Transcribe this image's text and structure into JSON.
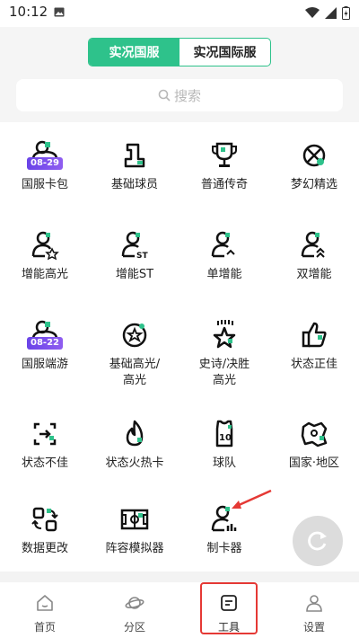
{
  "status": {
    "time": "10:12"
  },
  "server_tabs": [
    {
      "label": "实况国服",
      "active": true
    },
    {
      "label": "实况国际服",
      "active": false
    }
  ],
  "search": {
    "placeholder": "搜索"
  },
  "tools": [
    {
      "label": "国服卡包",
      "icon": "card-pack-icon",
      "badge": "08-29"
    },
    {
      "label": "基础球员",
      "icon": "base-player-icon"
    },
    {
      "label": "普通传奇",
      "icon": "trophy-icon"
    },
    {
      "label": "梦幻精选",
      "icon": "dream-select-icon"
    },
    {
      "label": "增能高光",
      "icon": "highlight-player-icon"
    },
    {
      "label": "增能ST",
      "icon": "st-player-icon"
    },
    {
      "label": "单增能",
      "icon": "single-boost-icon"
    },
    {
      "label": "双增能",
      "icon": "double-boost-icon"
    },
    {
      "label": "国服端游",
      "icon": "pc-pack-icon",
      "badge": "08-22"
    },
    {
      "label": "基础高光/\n高光",
      "icon": "star-circle-icon"
    },
    {
      "label": "史诗/决胜\n高光",
      "icon": "epic-star-icon"
    },
    {
      "label": "状态正佳",
      "icon": "thumbs-up-icon"
    },
    {
      "label": "状态不佳",
      "icon": "bad-form-icon"
    },
    {
      "label": "状态火热卡",
      "icon": "flame-icon"
    },
    {
      "label": "球队",
      "icon": "jersey-icon"
    },
    {
      "label": "国家·地区",
      "icon": "map-icon"
    },
    {
      "label": "数据更改",
      "icon": "data-change-icon"
    },
    {
      "label": "阵容模拟器",
      "icon": "pitch-icon"
    },
    {
      "label": "制卡器",
      "icon": "card-maker-icon"
    }
  ],
  "nav": [
    {
      "label": "首页",
      "icon": "home-icon"
    },
    {
      "label": "分区",
      "icon": "planet-icon"
    },
    {
      "label": "工具",
      "icon": "tools-icon",
      "active": true
    },
    {
      "label": "设置",
      "icon": "user-icon"
    }
  ],
  "colors": {
    "accent": "#2ec28b",
    "badge": "#6a44e8",
    "highlight": "#e53935"
  }
}
